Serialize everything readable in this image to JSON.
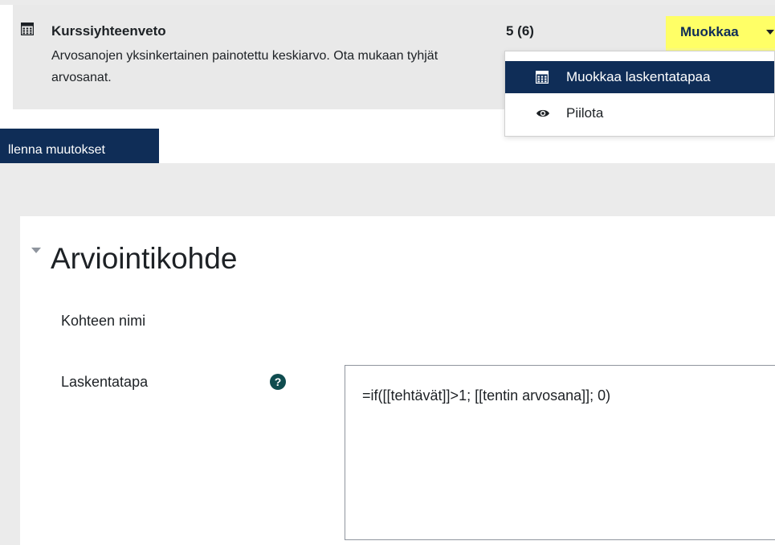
{
  "grade_item": {
    "title": "Kurssiyhteenveto",
    "description": "Arvosanojen yksinkertainen painotettu keskiarvo. Ota mukaan tyhjät arvosanat.",
    "weight": "5 (6)",
    "icon": "calculator-icon"
  },
  "edit_menu": {
    "button_label": "Muokkaa",
    "highlight_color": "#ffff66",
    "items": [
      {
        "label": "Muokkaa laskentatapaa",
        "icon": "calculator-icon",
        "active": true
      },
      {
        "label": "Piilota",
        "icon": "eye-icon",
        "active": false
      }
    ]
  },
  "save_button": {
    "label": "llenna muutokset"
  },
  "form": {
    "section_title": "Arviointikohde",
    "fields": [
      {
        "label": "Kohteen nimi"
      },
      {
        "label": "Laskentatapa",
        "help_icon": "question-icon",
        "value": "=if([[tehtävät]]>1; [[tentin arvosana]]; 0)"
      }
    ]
  },
  "colors": {
    "brand_navy": "#0f2d57",
    "help_icon": "#0f4c4f",
    "background": "#ebebeb"
  }
}
